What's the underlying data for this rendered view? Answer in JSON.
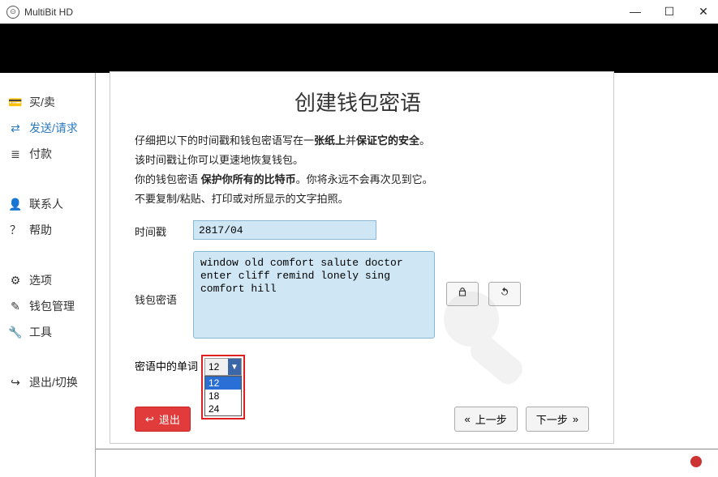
{
  "window": {
    "title": "MultiBit HD"
  },
  "sidebar": {
    "items": [
      {
        "icon": "💳",
        "label": "买/卖"
      },
      {
        "icon": "⇄",
        "label": "发送/请求",
        "active": true
      },
      {
        "icon": "≣",
        "label": "付款"
      },
      {
        "icon": "👤",
        "label": "联系人"
      },
      {
        "icon": "？",
        "label": "帮助"
      },
      {
        "icon": "⚙",
        "label": "选项"
      },
      {
        "icon": "✎",
        "label": "钱包管理"
      },
      {
        "icon": "🔧",
        "label": "工具"
      },
      {
        "icon": "↪",
        "label": "退出/切换"
      }
    ]
  },
  "modal": {
    "title": "创建钱包密语",
    "p1a": "仔细把以下的时间戳和钱包密语写在一",
    "p1b": "张纸上",
    "p1c": "并",
    "p1d": "保证它的安全",
    "p1e": "。",
    "p2": "该时间戳让你可以更速地恢复钱包。",
    "p3a": "你的钱包密语 ",
    "p3b": "保护你所有的比特币",
    "p3c": "。你将永远不会再次见到它。",
    "p4": "不要复制/粘贴、打印或对所显示的文字拍照。",
    "timestamp_label": "时间戳",
    "timestamp_value": "2817/04",
    "seed_label": "钱包密语",
    "seed_value": "window old comfort salute doctor enter cliff remind lonely sing comfort hill",
    "wordcount_label": "密语中的单词",
    "wordcount_selected": "12",
    "wordcount_options": [
      "12",
      "18",
      "24"
    ],
    "exit_label": "退出",
    "prev_label": "上一步",
    "next_label": "下一步"
  }
}
